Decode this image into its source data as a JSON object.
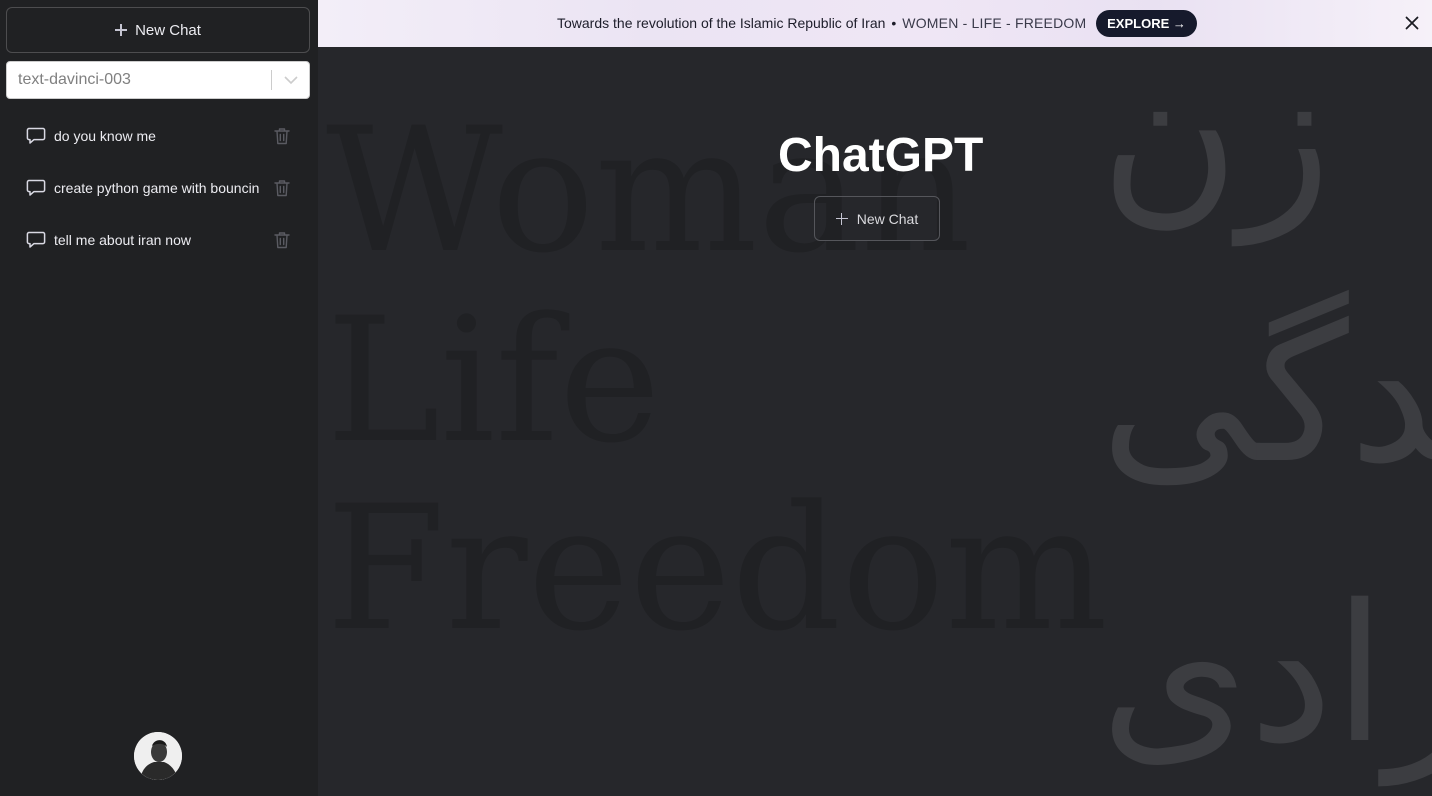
{
  "sidebar": {
    "new_chat_label": "New Chat",
    "model": {
      "value": "text-davinci-003"
    },
    "conversations": [
      {
        "label": "do you know me"
      },
      {
        "label": "create python game with bouncin"
      },
      {
        "label": "tell me about iran now"
      }
    ]
  },
  "banner": {
    "text": "Towards the revolution of the Islamic Republic of Iran",
    "separator": "•",
    "slogan": "WOMEN - LIFE - FREEDOM",
    "explore_label": "EXPLORE →"
  },
  "main": {
    "title": "ChatGPT",
    "new_chat_label": "New Chat",
    "background": {
      "english_lines": [
        "Woman",
        "Life",
        "Freedom"
      ],
      "persian_lines": [
        "زن",
        "زندگی",
        "آزادی"
      ]
    }
  },
  "colors": {
    "sidebar_bg": "#202123",
    "main_bg": "#26272b",
    "explore_bg": "#161a2c"
  }
}
